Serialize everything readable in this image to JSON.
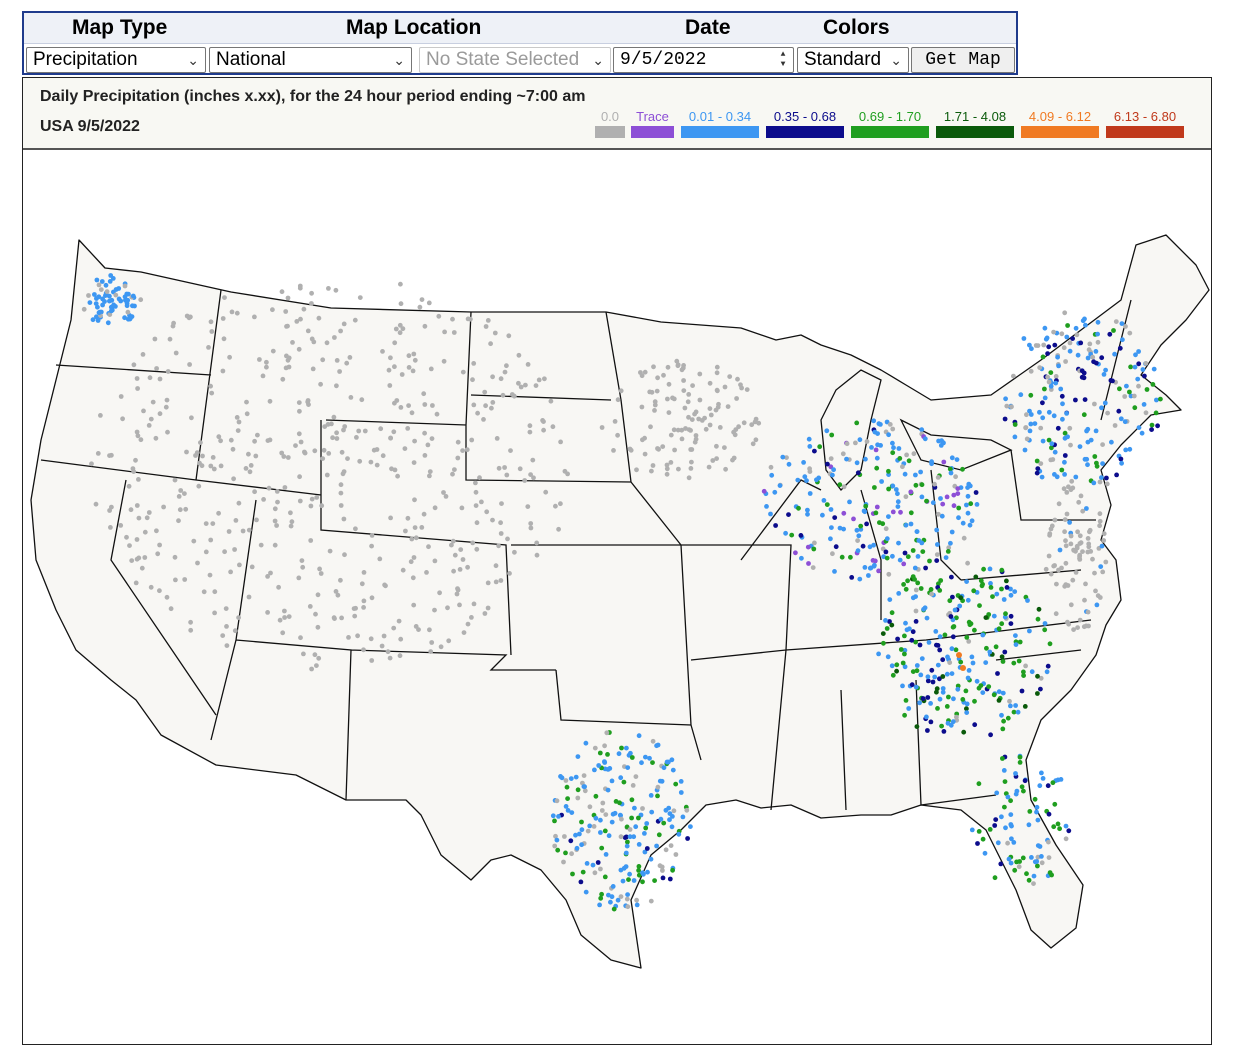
{
  "controls": {
    "headers": {
      "map_type": "Map Type",
      "map_location": "Map Location",
      "date": "Date",
      "colors": "Colors"
    },
    "map_type_value": "Precipitation",
    "location_value": "National",
    "state_value": "No State Selected",
    "date_value": "9/5/2022",
    "colors_value": "Standard",
    "get_map_label": "Get Map"
  },
  "legend": {
    "title": "Daily Precipitation (inches  x.xx),  for the 24 hour period ending ~7:00 am",
    "subtitle": "USA 9/5/2022",
    "bins": [
      {
        "label": "0.0",
        "color": "#b0b0b0"
      },
      {
        "label": "Trace",
        "color": "#8d4fd6"
      },
      {
        "label": "0.01 - 0.34",
        "color": "#3d97f2"
      },
      {
        "label": "0.35 - 0.68",
        "color": "#0c0c8c"
      },
      {
        "label": "0.69 - 1.70",
        "color": "#1f9e1f"
      },
      {
        "label": "1.71 - 4.08",
        "color": "#0a5a0a"
      },
      {
        "label": "4.09 - 6.12",
        "color": "#f07a22"
      },
      {
        "label": "6.13 - 6.80",
        "color": "#c0391b"
      }
    ]
  },
  "map_icons": {
    "station_dot": "circle-marker"
  }
}
